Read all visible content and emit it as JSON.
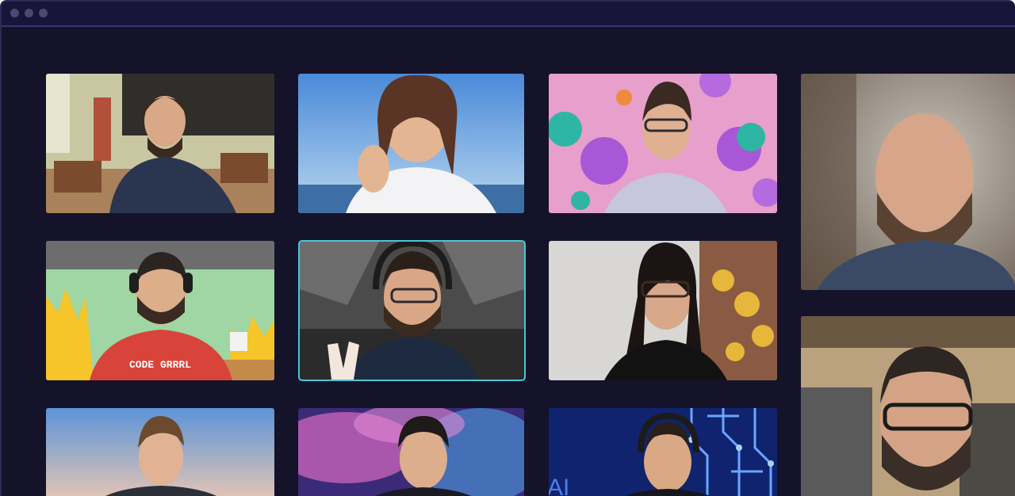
{
  "window": {
    "controls": [
      "window-dot",
      "window-dot",
      "window-dot"
    ],
    "active_color": "#49c6d6",
    "background": "#14132a"
  },
  "participants": [
    {
      "id": "classroom",
      "background": "classroom",
      "active": false
    },
    {
      "id": "beach",
      "background": "beach",
      "active": false
    },
    {
      "id": "spheres",
      "background": "spheres",
      "active": false
    },
    {
      "id": "fire",
      "background": "fire",
      "shirt_text": "CODE GRRRL",
      "active": false
    },
    {
      "id": "cockpit",
      "background": "cockpit",
      "active": true
    },
    {
      "id": "flowers",
      "background": "flowers",
      "active": false
    },
    {
      "id": "sky",
      "background": "sky",
      "active": false
    },
    {
      "id": "nebula",
      "background": "nebula",
      "active": false
    },
    {
      "id": "circuit",
      "background": "circuit",
      "overlay_text": "AI",
      "active": false
    },
    {
      "id": "right-top",
      "background": "room",
      "active": false
    },
    {
      "id": "right-bottom",
      "background": "room",
      "active": false
    }
  ]
}
